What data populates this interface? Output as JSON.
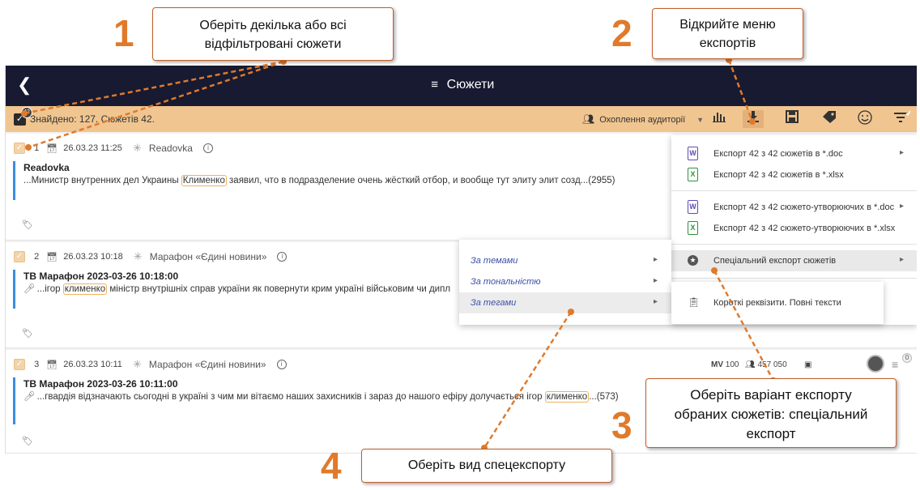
{
  "app": {
    "back_icon": "chevron-left-icon",
    "title": "Сюжети",
    "found_text": "Знайдено: 127. Сюжетів 42.",
    "selected_badge": "42",
    "audience_label": "Охоплення аудиторії"
  },
  "toolbar": {
    "icons": [
      "bar-chart-icon",
      "download-icon",
      "save-icon",
      "tag-icon",
      "smiley-icon",
      "filter-icon"
    ]
  },
  "stories": [
    {
      "num": "1",
      "date": "26.03.23 11:25",
      "source": "Readovka",
      "headline": "Readovka",
      "text_before": "...Министр внутренних дел Украины ",
      "highlight": "Клименко",
      "text_after": " заявил, что в подразделение очень жёсткий отбор, и вообще тут элиту элит созд...(2955)"
    },
    {
      "num": "2",
      "date": "26.03.23 10:18",
      "source": "Марафон «Єдині новини»",
      "headline": "ТВ Марафон 2023-03-26 10:18:00",
      "text_before": "...ігор ",
      "highlight": "клименко",
      "text_after": " міністр внутрішніх справ україни як повернути крим україні військовим чи дипл"
    },
    {
      "num": "3",
      "date": "26.03.23 10:11",
      "source": "Марафон «Єдині новини»",
      "headline": "ТВ Марафон 2023-03-26 10:11:00",
      "text_before": "...гвардія відзначають сьогодні в україні з чим ми вітаємо наших захисників і зараз до нашого ефіру долучається ігор ",
      "highlight": "клименко",
      "text_after": "...(573)",
      "mv": "100",
      "audience": "457 050",
      "menu_badge": "0"
    }
  ],
  "export_menu": {
    "items": [
      {
        "label": "Експорт 42 з 42 сюжетів в *.doc",
        "type": "W"
      },
      {
        "label": "Експорт 42 з 42 сюжетів в *.xlsx",
        "type": "X"
      },
      {
        "label": "Експорт 42 з 42 сюжето-утворюючих в *.doc",
        "type": "W"
      },
      {
        "label": "Експорт 42 з 42 сюжето-утворюючих в *.xlsx",
        "type": "X"
      },
      {
        "label": "Спеціальний експорт сюжетів",
        "type": "star"
      }
    ]
  },
  "special_submenu": {
    "items": [
      "За темами",
      "За тональністю",
      "За тегами"
    ]
  },
  "report_menu": {
    "label": "Короткі реквізити. Повні тексти"
  },
  "annotations": {
    "step1": {
      "num": "1",
      "text_line1": "Оберіть декілька або всі",
      "text_line2": "відфільтровані сюжети"
    },
    "step2": {
      "num": "2",
      "text_line1": "Відкрийте меню",
      "text_line2": "експортів"
    },
    "step3": {
      "num": "3",
      "text_line1": "Оберіть варіант експорту",
      "text_line2": "обраних сюжетів: спеціальний",
      "text_line3": "експорт"
    },
    "step4": {
      "num": "4",
      "text": "Оберіть вид спецекспорту"
    }
  },
  "colors": {
    "topbar": "#171a31",
    "filterbar": "#f0c590",
    "accent_orange": "#e07a2a",
    "story_bar": "#3a8de0"
  }
}
